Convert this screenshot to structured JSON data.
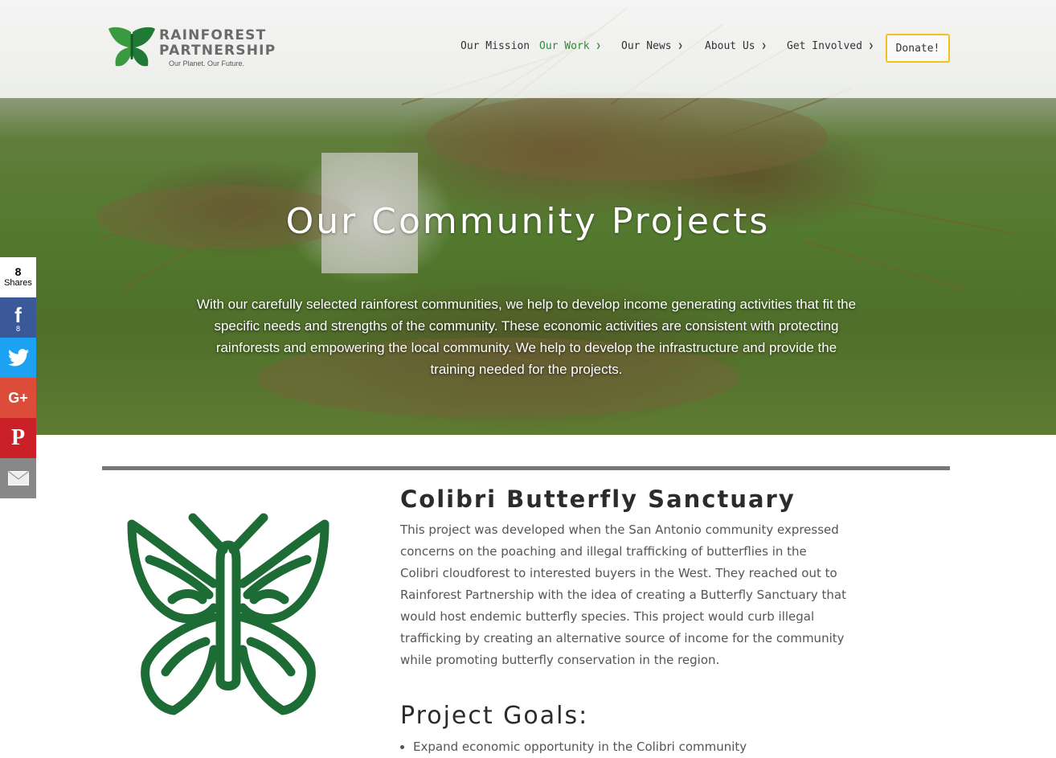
{
  "header": {
    "logo": {
      "line1": "RAINFOREST",
      "line2": "PARTNERSHIP",
      "tagline": "Our Planet. Our Future."
    },
    "nav": [
      {
        "label": "Our Mission",
        "has_dropdown": false,
        "active": false
      },
      {
        "label": "Our Work",
        "has_dropdown": true,
        "active": true
      },
      {
        "label": "Our News",
        "has_dropdown": true,
        "active": false
      },
      {
        "label": "About Us",
        "has_dropdown": true,
        "active": false
      },
      {
        "label": "Get Involved",
        "has_dropdown": true,
        "active": false
      }
    ],
    "donate_label": "Donate!"
  },
  "hero": {
    "title": "Our Community Projects",
    "text": "With our carefully selected rainforest communities, we help to develop income generating activities that fit the specific needs and strengths of the community. These economic activities are consistent with protecting rainforests and empowering the local community. We help to develop the infrastructure and provide the training needed for the projects."
  },
  "share": {
    "count": "8",
    "count_label": "Shares",
    "buttons": [
      {
        "network": "facebook",
        "icon": "facebook-icon",
        "count": "8",
        "color": "#3b5998"
      },
      {
        "network": "twitter",
        "icon": "twitter-icon",
        "count": "",
        "color": "#1da1f2"
      },
      {
        "network": "google-plus",
        "icon": "google-plus-icon",
        "count": "",
        "color": "#dd4b39"
      },
      {
        "network": "pinterest",
        "icon": "pinterest-icon",
        "count": "",
        "color": "#cb2027"
      },
      {
        "network": "email",
        "icon": "email-icon",
        "count": "",
        "color": "#888888"
      }
    ]
  },
  "project": {
    "title": "Colibri Butterfly Sanctuary",
    "description": "This project was developed when the San Antonio community expressed concerns on the poaching and illegal trafficking of butterflies in the Colibri cloudforest to interested buyers in the West. They reached out to Rainforest Partnership with the idea of creating a Butterfly Sanctuary that would host endemic butterfly species. This project would curb illegal trafficking by creating an alternative source of income for the community while promoting butterfly conservation in the region.",
    "goals_title": "Project Goals:",
    "goals": [
      "Expand economic opportunity in the Colibri community"
    ]
  },
  "colors": {
    "brand_green": "#2e8b3a",
    "butterfly_green": "#1d6b35",
    "donate_border": "#f2c21b",
    "divider": "#777777"
  }
}
